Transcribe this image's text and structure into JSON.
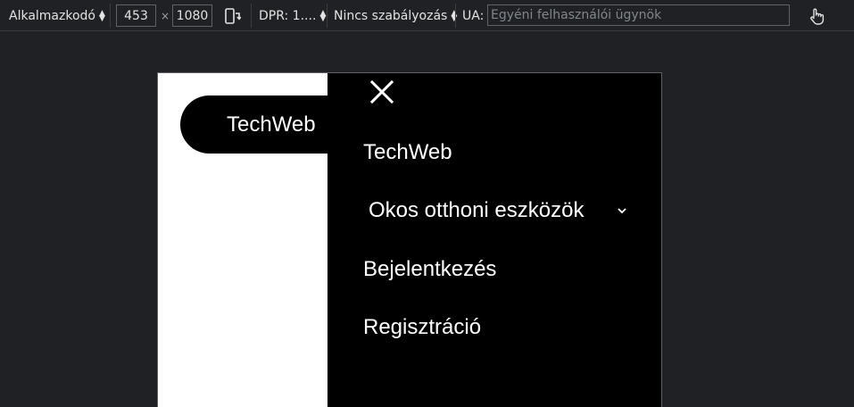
{
  "toolbar": {
    "dimensions_mode": "Alkalmazkodó",
    "width": "453",
    "times": "×",
    "height": "1080",
    "dpr": "DPR: 1....",
    "throttling": "Nincs szabályozás",
    "ua_label": "UA:",
    "ua_placeholder": "Egyéni felhasználói ügynök"
  },
  "page": {
    "brand": "TechWeb",
    "drawer": {
      "brand": "TechWeb",
      "items": [
        {
          "label": "Okos otthoni eszközök"
        },
        {
          "label": "Bejelentkezés"
        },
        {
          "label": "Regisztráció"
        }
      ]
    }
  },
  "icons": {
    "rotate": "rotate-device-icon",
    "touch": "touch-hand-icon",
    "close": "close-icon",
    "chevron": "chevron-down-icon"
  },
  "colors": {
    "devtools_bg": "#202124",
    "drawer_bg": "#000000",
    "page_bg": "#ffffff"
  }
}
